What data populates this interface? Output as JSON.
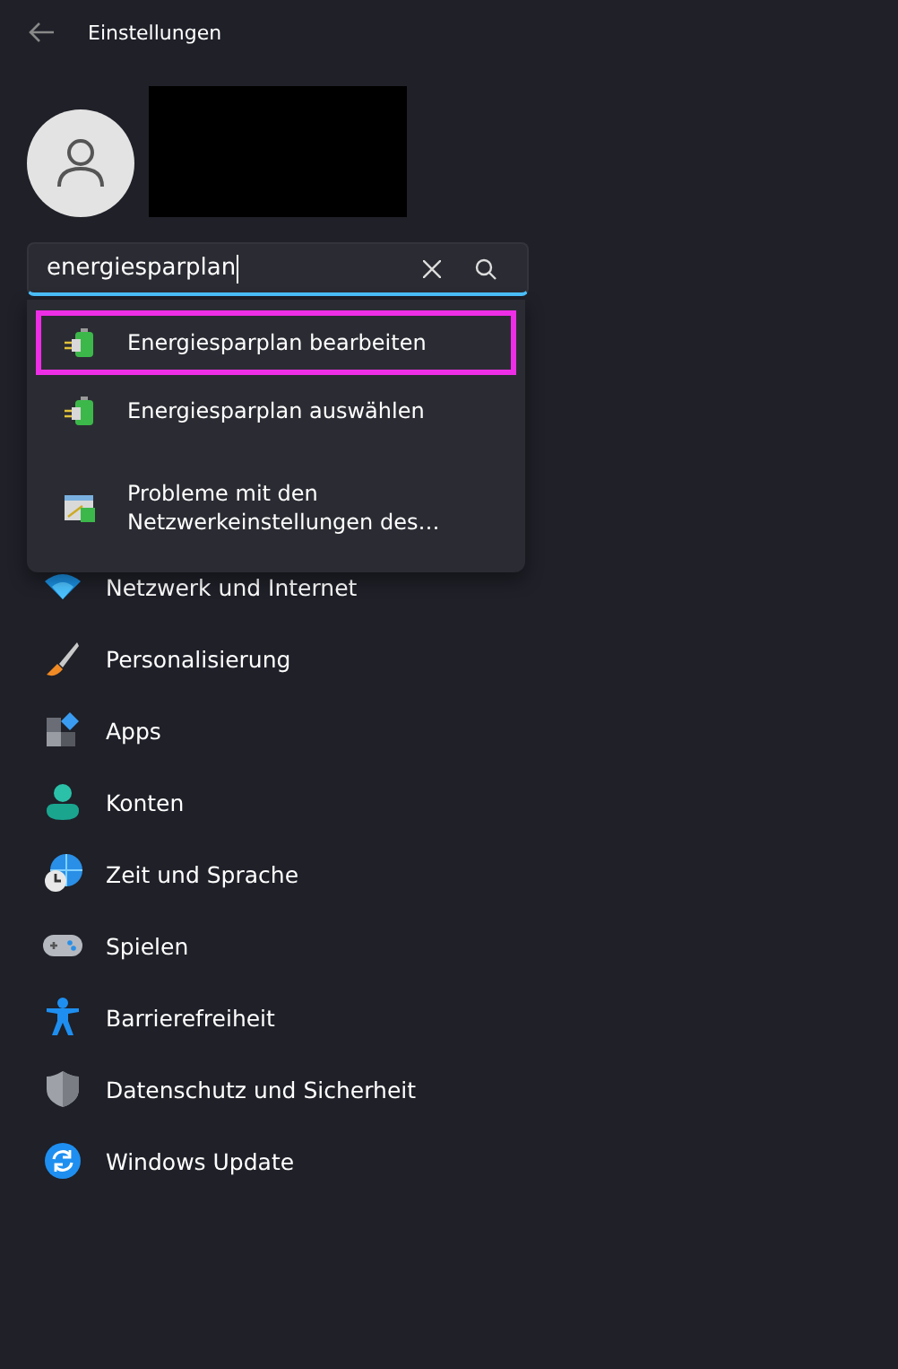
{
  "window": {
    "title": "Einstellungen"
  },
  "search": {
    "value": "energiesparplan"
  },
  "suggestions": [
    {
      "kind": "power",
      "label": "Energiesparplan bearbeiten",
      "highlighted": true
    },
    {
      "kind": "power",
      "label": "Energiesparplan auswählen",
      "highlighted": false
    },
    {
      "kind": "network",
      "label": "Probleme mit den Netzwerkeinstellungen des…",
      "highlighted": false
    }
  ],
  "nav": [
    {
      "kind": "wifi",
      "label": "Netzwerk und Internet"
    },
    {
      "kind": "brush",
      "label": "Personalisierung"
    },
    {
      "kind": "apps",
      "label": "Apps"
    },
    {
      "kind": "person",
      "label": "Konten"
    },
    {
      "kind": "globe",
      "label": "Zeit und Sprache"
    },
    {
      "kind": "gamepad",
      "label": "Spielen"
    },
    {
      "kind": "access",
      "label": "Barrierefreiheit"
    },
    {
      "kind": "shield",
      "label": "Datenschutz und Sicherheit"
    },
    {
      "kind": "update",
      "label": "Windows Update"
    }
  ]
}
